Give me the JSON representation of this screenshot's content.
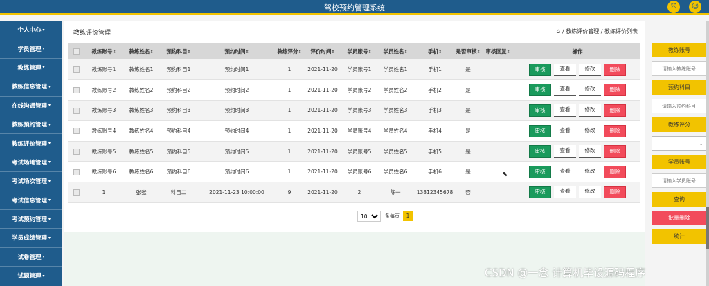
{
  "app": {
    "title": "驾校预约管理系统"
  },
  "topbar": {
    "fullscreen_icon": "⤧",
    "user_icon": "☺"
  },
  "sidebar": {
    "items": [
      {
        "label": "个人中心"
      },
      {
        "label": "学员管理"
      },
      {
        "label": "教练管理"
      },
      {
        "label": "教练信息管理"
      },
      {
        "label": "在线沟通管理"
      },
      {
        "label": "教练预约管理"
      },
      {
        "label": "教练评价管理"
      },
      {
        "label": "考试场地管理"
      },
      {
        "label": "考试场次管理"
      },
      {
        "label": "考试信息管理"
      },
      {
        "label": "考试预约管理"
      },
      {
        "label": "学员成绩管理"
      },
      {
        "label": "试卷管理"
      },
      {
        "label": "试题管理"
      }
    ]
  },
  "panel": {
    "title": "教练评价管理"
  },
  "breadcrumb": {
    "home_icon": "⌂",
    "sep": "/",
    "level1": "教练评价管理",
    "level2": "教练评价列表"
  },
  "table": {
    "headers": {
      "coach_no": "教练账号",
      "coach_name": "教练姓名",
      "subject": "预约科目",
      "time": "预约时间",
      "score": "教练评分",
      "eval_time": "评价时间",
      "student_no": "学员账号",
      "student_name": "学员姓名",
      "phone": "手机",
      "approved": "是否审核",
      "reply": "审核回复",
      "ops": "操作"
    },
    "sort_mark": "⇕",
    "rows": [
      {
        "coach_no": "教练账号1",
        "coach_name": "教练姓名1",
        "subject": "预约科目1",
        "time": "预约时间1",
        "score": "1",
        "eval_time": "2021-11-20",
        "student_no": "学员账号1",
        "student_name": "学员姓名1",
        "phone": "手机1",
        "approved": "是",
        "reply": ""
      },
      {
        "coach_no": "教练账号2",
        "coach_name": "教练姓名2",
        "subject": "预约科目2",
        "time": "预约时间2",
        "score": "1",
        "eval_time": "2021-11-20",
        "student_no": "学员账号2",
        "student_name": "学员姓名2",
        "phone": "手机2",
        "approved": "是",
        "reply": ""
      },
      {
        "coach_no": "教练账号3",
        "coach_name": "教练姓名3",
        "subject": "预约科目3",
        "time": "预约时间3",
        "score": "1",
        "eval_time": "2021-11-20",
        "student_no": "学员账号3",
        "student_name": "学员姓名3",
        "phone": "手机3",
        "approved": "是",
        "reply": ""
      },
      {
        "coach_no": "教练账号4",
        "coach_name": "教练姓名4",
        "subject": "预约科目4",
        "time": "预约时间4",
        "score": "1",
        "eval_time": "2021-11-20",
        "student_no": "学员账号4",
        "student_name": "学员姓名4",
        "phone": "手机4",
        "approved": "是",
        "reply": ""
      },
      {
        "coach_no": "教练账号5",
        "coach_name": "教练姓名5",
        "subject": "预约科目5",
        "time": "预约时间5",
        "score": "1",
        "eval_time": "2021-11-20",
        "student_no": "学员账号5",
        "student_name": "学员姓名5",
        "phone": "手机5",
        "approved": "是",
        "reply": ""
      },
      {
        "coach_no": "教练账号6",
        "coach_name": "教练姓名6",
        "subject": "预约科目6",
        "time": "预约时间6",
        "score": "1",
        "eval_time": "2021-11-20",
        "student_no": "学员账号6",
        "student_name": "学员姓名6",
        "phone": "手机6",
        "approved": "是",
        "reply": ""
      },
      {
        "coach_no": "1",
        "coach_name": "张张",
        "subject": "科目二",
        "time": "2021-11-23 10:00:00",
        "score": "9",
        "eval_time": "2021-11-20",
        "student_no": "2",
        "student_name": "陈一",
        "phone": "13812345678",
        "approved": "否",
        "reply": ""
      }
    ],
    "buttons": {
      "audit": "审核",
      "view": "查看",
      "edit": "修改",
      "delete": "删除"
    }
  },
  "pager": {
    "page_size": "10",
    "per_page_label": "条每页",
    "current_page": "1"
  },
  "filters": {
    "coach_no_label": "教练账号",
    "coach_no_placeholder": "请输入教练账号",
    "subject_label": "预约科目",
    "subject_placeholder": "请输入预约科目",
    "score_label": "教练评分",
    "student_no_label": "学员账号",
    "student_no_placeholder": "请输入学员账号",
    "query": "查询",
    "batch_delete": "批量删除",
    "stats": "统计"
  },
  "watermark": "CSDN @一念 计算机毕设源码程序",
  "colors": {
    "primary": "#1f5c8c",
    "accent": "#f2c300",
    "success": "#1a9a5c",
    "danger": "#f24b5b"
  }
}
